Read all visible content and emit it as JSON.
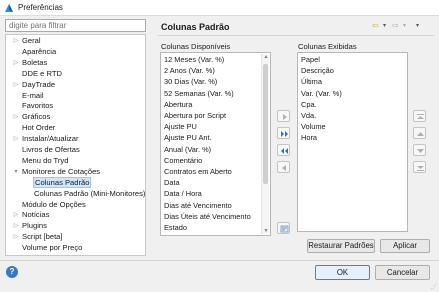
{
  "window": {
    "title": "Preferências"
  },
  "filter": {
    "placeholder": "digite para filtrar"
  },
  "tree": [
    {
      "label": "Geral",
      "expandable": true
    },
    {
      "label": "Aparência",
      "expandable": false
    },
    {
      "label": "Boletas",
      "expandable": true
    },
    {
      "label": "DDE e RTD",
      "expandable": false
    },
    {
      "label": "DayTrade",
      "expandable": true
    },
    {
      "label": "E-mail",
      "expandable": false
    },
    {
      "label": "Favoritos",
      "expandable": false
    },
    {
      "label": "Gráficos",
      "expandable": true
    },
    {
      "label": "Hot Order",
      "expandable": false
    },
    {
      "label": "Instalar/Atualizar",
      "expandable": true
    },
    {
      "label": "Livros de Ofertas",
      "expandable": false
    },
    {
      "label": "Menu do Tryd",
      "expandable": false
    },
    {
      "label": "Monitores de Cotações",
      "expandable": true,
      "expanded": true
    },
    {
      "label": "Colunas Padrão",
      "child": true,
      "selected": true
    },
    {
      "label": "Colunas Padrão (Mini-Monitores)",
      "child": true
    },
    {
      "label": "Módulo de Opções",
      "expandable": false
    },
    {
      "label": "Notícias",
      "expandable": true
    },
    {
      "label": "Plugins",
      "expandable": true
    },
    {
      "label": "Script [beta]",
      "expandable": true
    },
    {
      "label": "Volume por Preço",
      "expandable": false
    }
  ],
  "page": {
    "title": "Colunas Padrão"
  },
  "available": {
    "label": "Colunas Disponíveis",
    "items": [
      "12 Meses (Var. %)",
      "2 Anos (Var. %)",
      "30 Dias (Var. %)",
      "52 Semanas (Var. %)",
      "Abertura",
      "Abertura por Script",
      "Ajuste PU",
      "Ajuste PU Ant.",
      "Anual (Var. %)",
      "Comentário",
      "Contratos em Aberto",
      "Data",
      "Data / Hora",
      "Dias até Vencimento",
      "Dias Úteis até Vencimento",
      "Estado"
    ]
  },
  "shown": {
    "label": "Colunas Exibidas",
    "items": [
      "Papel",
      "Descrição",
      "Última",
      "Var. (Var. %)",
      "Cpa.",
      "Vda.",
      "Volume",
      "Hora"
    ]
  },
  "buttons": {
    "restore": "Restaurar Padrões",
    "apply": "Aplicar",
    "ok": "OK",
    "cancel": "Cancelar"
  }
}
